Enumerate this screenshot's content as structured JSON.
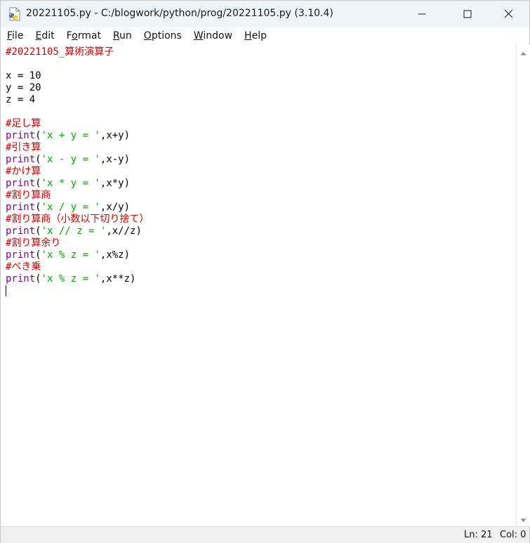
{
  "window": {
    "title": "20221105.py - C:/blogwork/python/prog/20221105.py (3.10.4)",
    "controls": {
      "minimize_icon": "minimize-icon",
      "maximize_icon": "maximize-icon",
      "close_icon": "close-icon"
    }
  },
  "menu": {
    "items": [
      {
        "key": "F",
        "rest": "ile"
      },
      {
        "key": "E",
        "rest": "dit"
      },
      {
        "key": "",
        "pre": "F",
        "key2": "o",
        "rest": "rmat"
      },
      {
        "key": "R",
        "rest": "un"
      },
      {
        "key": "O",
        "rest": "ptions"
      },
      {
        "key": "W",
        "rest": "indow"
      },
      {
        "key": "H",
        "rest": "elp"
      }
    ],
    "labels": [
      "File",
      "Edit",
      "Format",
      "Run",
      "Options",
      "Window",
      "Help"
    ]
  },
  "editor": {
    "lines": [
      [
        {
          "t": "#20221105_算術演算子",
          "c": "comment"
        }
      ],
      [],
      [
        {
          "t": "x = 10",
          "c": "plain"
        }
      ],
      [
        {
          "t": "y = 20",
          "c": "plain"
        }
      ],
      [
        {
          "t": "z = 4",
          "c": "plain"
        }
      ],
      [],
      [
        {
          "t": "#足し算",
          "c": "comment"
        }
      ],
      [
        {
          "t": "print",
          "c": "builtin"
        },
        {
          "t": "(",
          "c": "plain"
        },
        {
          "t": "'x + y = '",
          "c": "string"
        },
        {
          "t": ",x+y)",
          "c": "plain"
        }
      ],
      [
        {
          "t": "#引き算",
          "c": "comment"
        }
      ],
      [
        {
          "t": "print",
          "c": "builtin"
        },
        {
          "t": "(",
          "c": "plain"
        },
        {
          "t": "'x - y = '",
          "c": "string"
        },
        {
          "t": ",x-y)",
          "c": "plain"
        }
      ],
      [
        {
          "t": "#かけ算",
          "c": "comment"
        }
      ],
      [
        {
          "t": "print",
          "c": "builtin"
        },
        {
          "t": "(",
          "c": "plain"
        },
        {
          "t": "'x * y = '",
          "c": "string"
        },
        {
          "t": ",x*y)",
          "c": "plain"
        }
      ],
      [
        {
          "t": "#割り算商",
          "c": "comment"
        }
      ],
      [
        {
          "t": "print",
          "c": "builtin"
        },
        {
          "t": "(",
          "c": "plain"
        },
        {
          "t": "'x / y = '",
          "c": "string"
        },
        {
          "t": ",x/y)",
          "c": "plain"
        }
      ],
      [
        {
          "t": "#割り算商（小数以下切り捨て）",
          "c": "comment"
        }
      ],
      [
        {
          "t": "print",
          "c": "builtin"
        },
        {
          "t": "(",
          "c": "plain"
        },
        {
          "t": "'x // z = '",
          "c": "string"
        },
        {
          "t": ",x//z)",
          "c": "plain"
        }
      ],
      [
        {
          "t": "#割り算余り",
          "c": "comment"
        }
      ],
      [
        {
          "t": "print",
          "c": "builtin"
        },
        {
          "t": "(",
          "c": "plain"
        },
        {
          "t": "'x % z = '",
          "c": "string"
        },
        {
          "t": ",x%z)",
          "c": "plain"
        }
      ],
      [
        {
          "t": "#べき乗",
          "c": "comment"
        }
      ],
      [
        {
          "t": "print",
          "c": "builtin"
        },
        {
          "t": "(",
          "c": "plain"
        },
        {
          "t": "'x % z = '",
          "c": "string"
        },
        {
          "t": ",x**z)",
          "c": "plain"
        }
      ]
    ],
    "colors": {
      "comment": "#dd0000",
      "builtin": "#900090",
      "string": "#00aa00",
      "plain": "#000000"
    }
  },
  "status": {
    "line": "Ln: 21",
    "col": "Col: 0"
  }
}
